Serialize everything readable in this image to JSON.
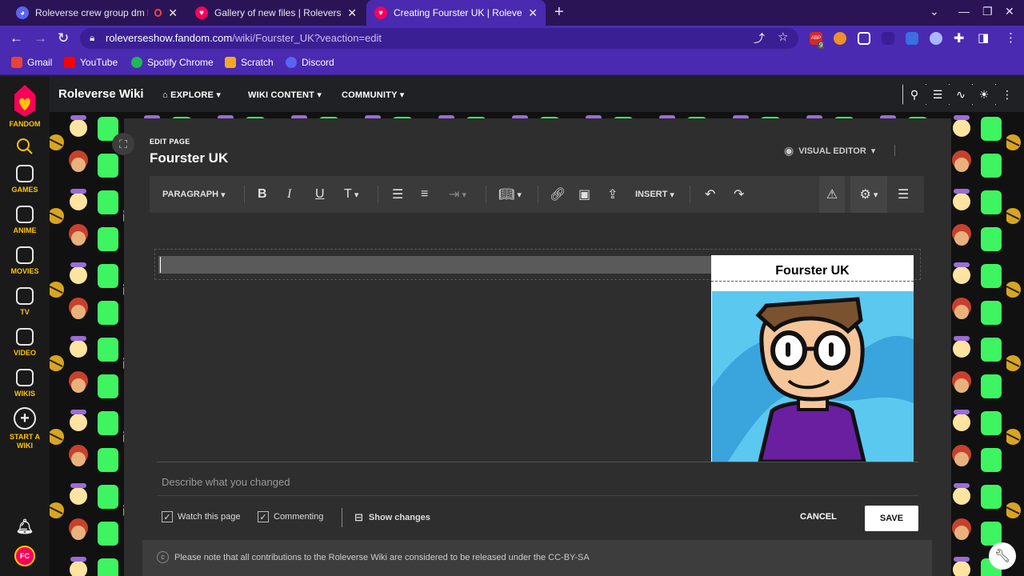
{
  "browser": {
    "tabs": [
      {
        "title": "Roleverse crew group dm be",
        "favicon_color": "#5865f2",
        "active": false
      },
      {
        "title": "Gallery of new files | Roleverse W",
        "favicon_color": "#fa005a",
        "active": false
      },
      {
        "title": "Creating Fourster UK | Roleverse",
        "favicon_color": "#fa005a",
        "active": true
      }
    ],
    "new_tab": "+",
    "url_host": "roleverseshow.fandom.com",
    "url_path": "/wiki/Fourster_UK?veaction=edit",
    "abp_badge": "9",
    "bookmarks": [
      {
        "label": "Gmail",
        "color": "#ea4335"
      },
      {
        "label": "YouTube",
        "color": "#ff0000"
      },
      {
        "label": "Spotify Chrome",
        "color": "#1db954"
      },
      {
        "label": "Scratch",
        "color": "#f7a823"
      },
      {
        "label": "Discord",
        "color": "#5865f2"
      }
    ]
  },
  "rail": {
    "brand": "FANDOM",
    "items": [
      {
        "label": "GAMES"
      },
      {
        "label": "ANIME"
      },
      {
        "label": "MOVIES"
      },
      {
        "label": "TV"
      },
      {
        "label": "VIDEO"
      },
      {
        "label": "WIKIS"
      },
      {
        "label": "START A WIKI"
      }
    ],
    "avatar": "FC"
  },
  "wiki": {
    "name": "Roleverse Wiki",
    "nav": [
      "EXPLORE",
      "WIKI CONTENT",
      "COMMUNITY"
    ]
  },
  "editor": {
    "edit_label": "EDIT PAGE",
    "page_title": "Fourster UK",
    "mode": "VISUAL EDITOR",
    "toolbar": {
      "paragraph": "PARAGRAPH",
      "insert": "INSERT"
    },
    "infobox_title": "Fourster UK",
    "summary_placeholder": "Describe what you changed",
    "watch_label": "Watch this page",
    "commenting_label": "Commenting",
    "show_changes": "Show changes",
    "cancel": "CANCEL",
    "save": "SAVE",
    "license_text": "Please note that all contributions to the Roleverse Wiki are considered to be released under the CC-BY-SA"
  },
  "colors": {
    "browser_accent": "#4a2ab0",
    "fandom_yellow": "#ffc500",
    "pattern_green": "#3ef561",
    "pattern_purple": "#7b3fd0"
  }
}
